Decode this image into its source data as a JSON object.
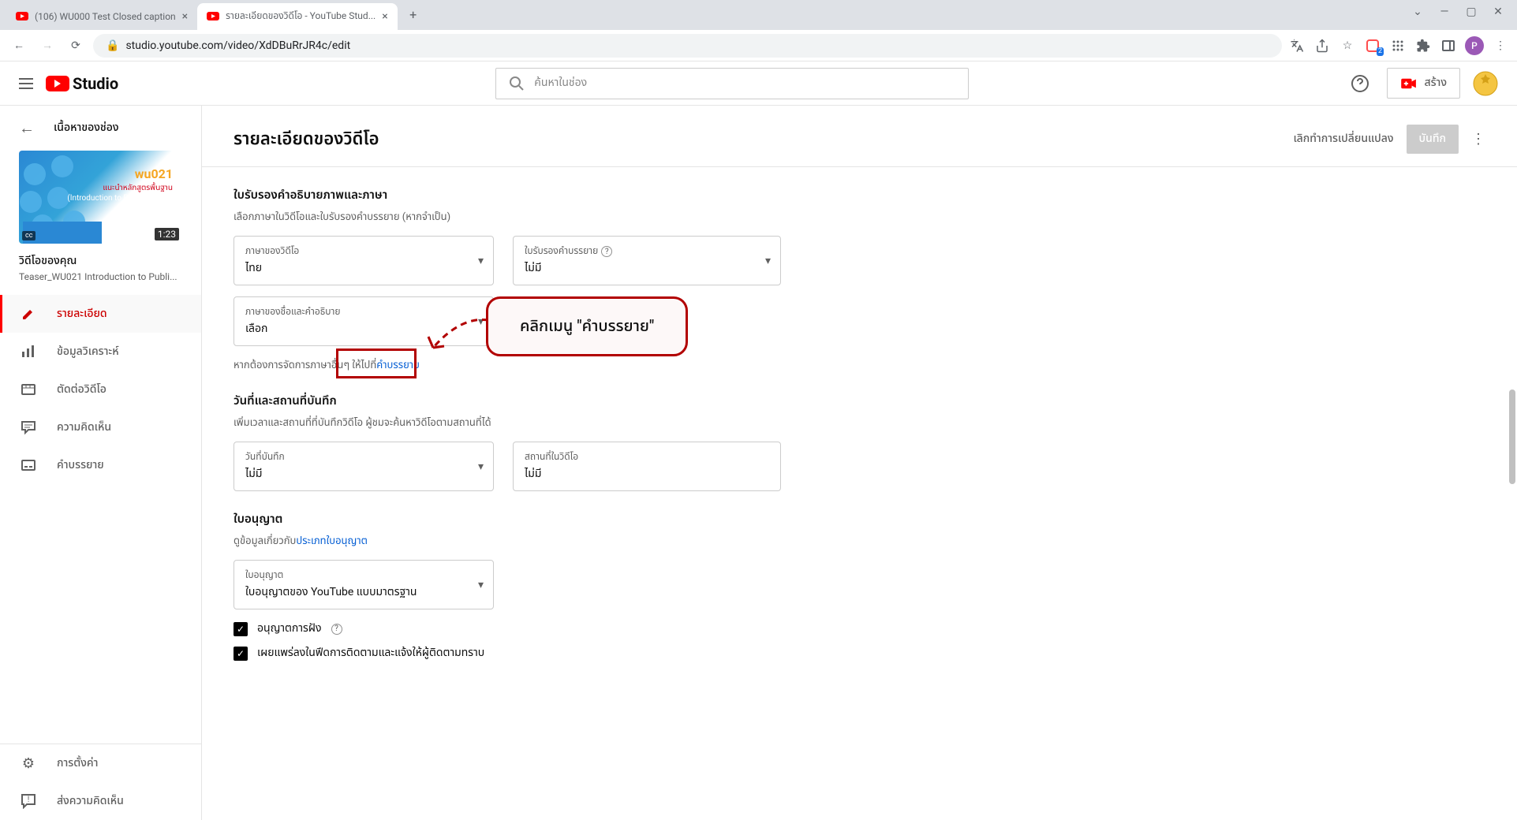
{
  "window": {
    "tabs": [
      {
        "title": "(106) WU000 Test Closed caption",
        "active": false
      },
      {
        "title": "รายละเอียดของวิดีโอ - YouTube Stud...",
        "active": true
      }
    ]
  },
  "address": {
    "url": "studio.youtube.com/video/XdDBuRrJR4c/edit"
  },
  "ext": {
    "badge": "2",
    "avatar_letter": "P"
  },
  "header": {
    "logo": "Studio",
    "search_placeholder": "ค้นหาในช่อง",
    "create": "สร้าง"
  },
  "sidebar": {
    "back": "เนื้อหาของช่อง",
    "thumb": {
      "code": "wu021",
      "line2": "แนะนำหลักสูตรพื้นฐาน",
      "line3": "(Introduction to Public Health)",
      "duration": "1:23",
      "cc": "cc"
    },
    "your_video": {
      "title": "วิดีโอของคุณ",
      "sub": "Teaser_WU021 Introduction to Publi..."
    },
    "items": [
      {
        "icon": "pencil",
        "label": "รายละเอียด",
        "active": true
      },
      {
        "icon": "chart",
        "label": "ข้อมูลวิเคราะห์"
      },
      {
        "icon": "film",
        "label": "ตัดต่อวิดีโอ"
      },
      {
        "icon": "comment",
        "label": "ความคิดเห็น"
      },
      {
        "icon": "cc",
        "label": "คำบรรยาย"
      }
    ],
    "bottom": [
      {
        "icon": "gear",
        "label": "การตั้งค่า"
      },
      {
        "icon": "feedback",
        "label": "ส่งความคิดเห็น"
      }
    ]
  },
  "page": {
    "title": "รายละเอียดของวิดีโอ",
    "undo": "เลิกทำการเปลี่ยนแปลง",
    "save": "บันทึก"
  },
  "section1": {
    "heading": "ใบรับรองคำอธิบายภาพและภาษา",
    "desc": "เลือกภาษาในวิดีโอและใบรับรองคำบรรยาย (หากจำเป็น)",
    "lang": {
      "label": "ภาษาของวิดีโอ",
      "value": "ไทย"
    },
    "cert": {
      "label": "ใบรับรองคำบรรยาย",
      "value": "ไม่มี"
    },
    "tdlang": {
      "label": "ภาษาของชื่อและคำอธิบาย",
      "value": "เลือก"
    },
    "note_pre": "หากต้องการจัดการภาษาอื่นๆ ให้ไปที่",
    "note_link": "คำบรรยาย"
  },
  "callout": {
    "text": "คลิกเมนู \"คำบรรยาย\""
  },
  "section2": {
    "heading": "วันที่และสถานที่บันทึก",
    "desc": "เพิ่มเวลาและสถานที่ที่บันทึกวิดีโอ ผู้ชมจะค้นหาวิดีโอตามสถานที่ได้",
    "date": {
      "label": "วันที่บันทึก",
      "value": "ไม่มี"
    },
    "place": {
      "label": "สถานที่ในวิดีโอ",
      "value": "ไม่มี"
    }
  },
  "section3": {
    "heading": "ใบอนุญาต",
    "desc_pre": "ดูข้อมูลเกี่ยวกับ",
    "desc_link": "ประเภทใบอนุญาต",
    "lic": {
      "label": "ใบอนุญาต",
      "value": "ใบอนุญาตของ YouTube แบบมาตรฐาน"
    },
    "cb1": "อนุญาตการฝัง",
    "cb2": "เผยแพร่ลงในฟีดการติดตามและแจ้งให้ผู้ติดตามทราบ"
  }
}
